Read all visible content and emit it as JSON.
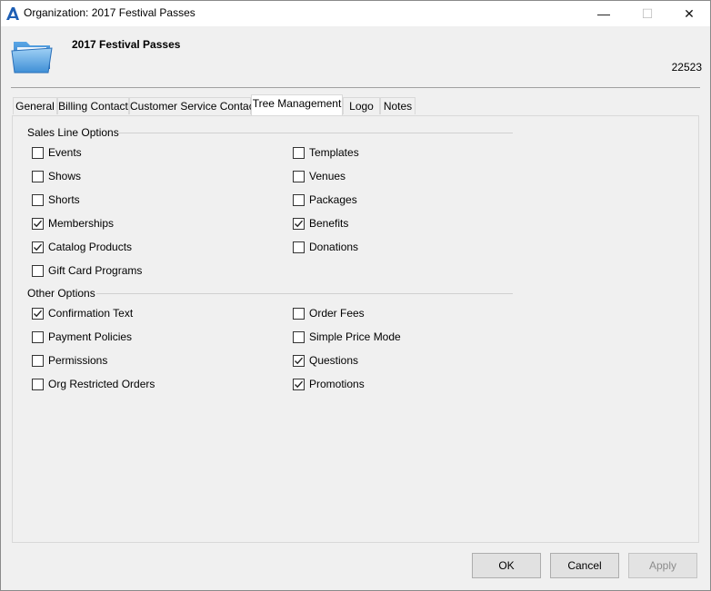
{
  "window": {
    "title": "Organization: 2017 Festival Passes",
    "min_symbol": "—",
    "max_symbol": "☐",
    "close_symbol": "✕"
  },
  "header": {
    "name": "2017 Festival Passes",
    "id": "22523",
    "icon": "folder-icon"
  },
  "tabs": [
    {
      "label": "General"
    },
    {
      "label": "Billing Contact"
    },
    {
      "label": "Customer Service Contact"
    },
    {
      "label": "Tree Management",
      "active": true
    },
    {
      "label": "Logo"
    },
    {
      "label": "Notes"
    }
  ],
  "sales_line_options": {
    "label": "Sales Line Options",
    "left": [
      {
        "label": "Events",
        "checked": false
      },
      {
        "label": "Shows",
        "checked": false
      },
      {
        "label": "Shorts",
        "checked": false
      },
      {
        "label": "Memberships",
        "checked": true
      },
      {
        "label": "Catalog Products",
        "checked": true
      },
      {
        "label": "Gift Card Programs",
        "checked": false
      }
    ],
    "right": [
      {
        "label": "Templates",
        "checked": false
      },
      {
        "label": "Venues",
        "checked": false
      },
      {
        "label": "Packages",
        "checked": false
      },
      {
        "label": "Benefits",
        "checked": true
      },
      {
        "label": "Donations",
        "checked": false
      }
    ]
  },
  "other_options": {
    "label": "Other Options",
    "left": [
      {
        "label": "Confirmation Text",
        "checked": true
      },
      {
        "label": "Payment Policies",
        "checked": false
      },
      {
        "label": "Permissions",
        "checked": false
      },
      {
        "label": "Org Restricted Orders",
        "checked": false
      }
    ],
    "right": [
      {
        "label": "Order Fees",
        "checked": false
      },
      {
        "label": "Simple Price Mode",
        "checked": false
      },
      {
        "label": "Questions",
        "checked": true
      },
      {
        "label": "Promotions",
        "checked": true
      }
    ]
  },
  "buttons": {
    "ok": "OK",
    "cancel": "Cancel",
    "apply": "Apply",
    "apply_enabled": false
  }
}
